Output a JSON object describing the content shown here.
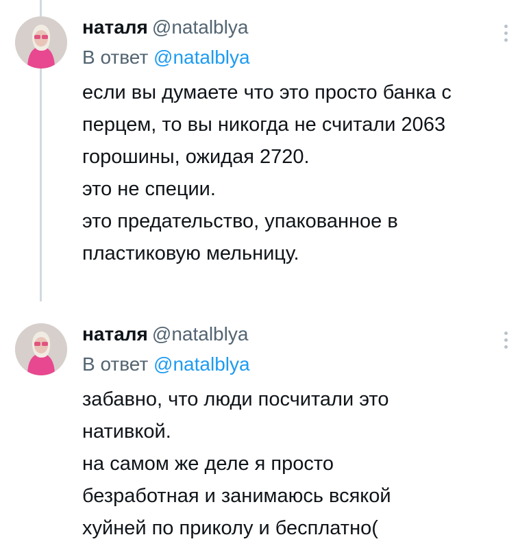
{
  "colors": {
    "text": "#0f1419",
    "secondary": "#536471",
    "link": "#1d9bf0",
    "thread_line": "#cfd9de"
  },
  "tweets": [
    {
      "name": "наталя",
      "handle": "@natalblya",
      "reply_prefix": "В ответ",
      "reply_to": "@natalblya",
      "lines": [
        "если вы думаете что это просто банка с",
        "перцем, то вы никогда не считали 2063",
        "горошины, ожидая 2720.",
        "это не специи.",
        "это предательство, упакованное в",
        "пластиковую мельницу."
      ],
      "menu_icon": "more-vertical-icon"
    },
    {
      "name": "наталя",
      "handle": "@natalblya",
      "reply_prefix": "В ответ",
      "reply_to": "@natalblya",
      "lines": [
        "забавно, что люди посчитали это",
        "нативкой.",
        "на самом же деле я просто",
        "безработная и занимаюсь всякой",
        "хуйней по приколу и бесплатно("
      ],
      "menu_icon": "more-vertical-icon"
    }
  ]
}
